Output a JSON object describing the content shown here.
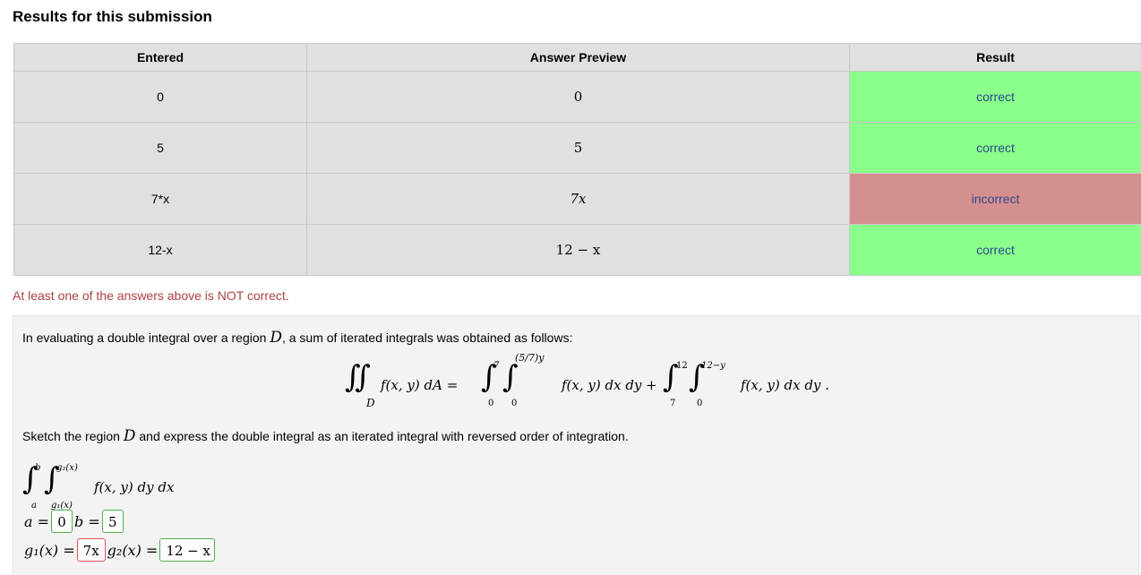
{
  "heading": "Results for this submission",
  "table": {
    "headers": [
      "Entered",
      "Answer Preview",
      "Result"
    ],
    "rows": [
      {
        "entered": "0",
        "preview": "0",
        "result": "correct",
        "status": "ok"
      },
      {
        "entered": "5",
        "preview": "5",
        "result": "correct",
        "status": "ok"
      },
      {
        "entered": "7*x",
        "preview": "7x",
        "result": "incorrect",
        "status": "bad"
      },
      {
        "entered": "12-x",
        "preview": "12 − x",
        "result": "correct",
        "status": "ok"
      }
    ]
  },
  "warning": "At least one of the answers above is NOT correct.",
  "problem": {
    "intro_pre": "In evaluating a double integral over a region ",
    "intro_var": "D",
    "intro_post": ", a sum of iterated integrals was obtained as follows:",
    "equation": {
      "lhs_integrand": "f(x, y) dA =",
      "region": "D",
      "int1_lower_outer": "0",
      "int1_upper_outer": "7",
      "int1_lower_inner": "0",
      "int1_upper_inner": "(5/7)y",
      "term1": "f(x, y) dx dy +",
      "int2_lower_outer": "7",
      "int2_upper_outer": "12",
      "int2_lower_inner": "0",
      "int2_upper_inner": "12−y",
      "term2": "f(x, y) dx dy ."
    },
    "sketch_pre": "Sketch the region ",
    "sketch_var": "D",
    "sketch_post": " and express the double integral as an iterated integral with reversed order of integration.",
    "answer_integral": {
      "outer_lower": "a",
      "outer_upper": "b",
      "inner_lower": "g₁(x)",
      "inner_upper": "g₂(x)",
      "integrand": "f(x, y) dy dx"
    },
    "fields": {
      "a_label": "a =",
      "a_value": "0",
      "b_label": "b =",
      "b_value": "5",
      "g1_label": "g₁(x) =",
      "g1_value": "7x",
      "g2_label": "g₂(x) =",
      "g2_value": "12 − x"
    }
  },
  "colors": {
    "correct_bg": "#8aff8a",
    "incorrect_bg": "#d68f8f",
    "warning": "#b04040"
  }
}
